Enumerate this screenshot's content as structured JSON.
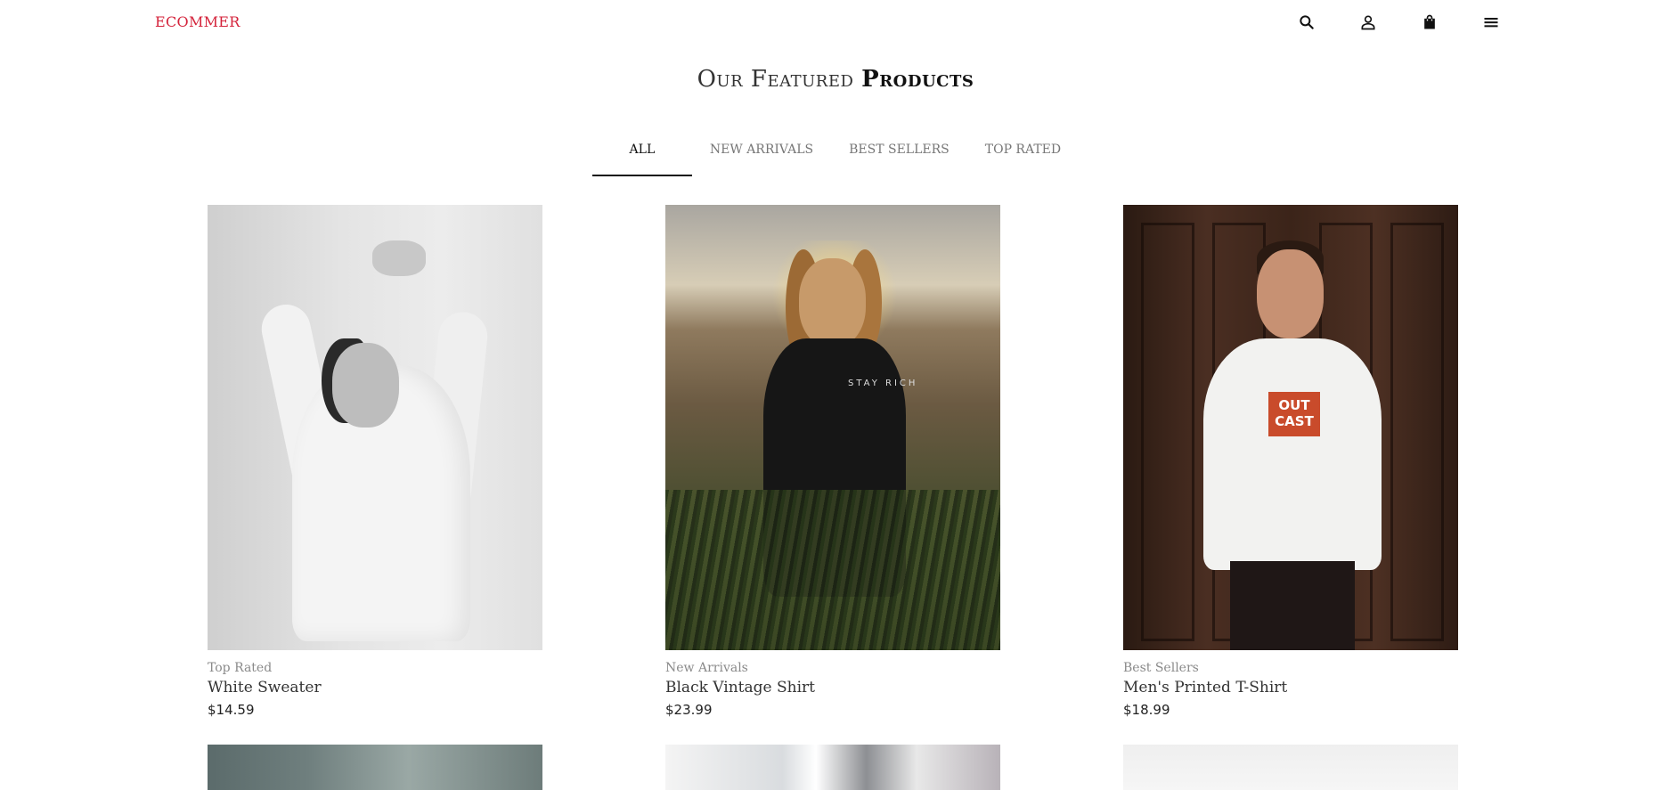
{
  "header": {
    "brand": "ECOMMER",
    "icons": [
      "search-icon",
      "user-icon",
      "bag-icon",
      "menu-icon"
    ]
  },
  "section": {
    "title_light": "Our Featured",
    "title_bold": "Products"
  },
  "tabs": [
    {
      "label": "ALL",
      "active": true
    },
    {
      "label": "NEW ARRIVALS",
      "active": false
    },
    {
      "label": "BEST SELLERS",
      "active": false
    },
    {
      "label": "TOP RATED",
      "active": false
    }
  ],
  "products": [
    {
      "category": "Top Rated",
      "name": "White Sweater",
      "price": "$14.59"
    },
    {
      "category": "New Arrivals",
      "name": "Black Vintage Shirt",
      "price": "$23.99",
      "image_text": "STAY RICH"
    },
    {
      "category": "Best Sellers",
      "name": "Men's Printed T-Shirt",
      "price": "$18.99",
      "image_text": "OUT CAST"
    }
  ],
  "colors": {
    "brand": "#d4233b",
    "text": "#222222",
    "muted": "#8a8a8a",
    "active_tab_underline": "#111111"
  }
}
